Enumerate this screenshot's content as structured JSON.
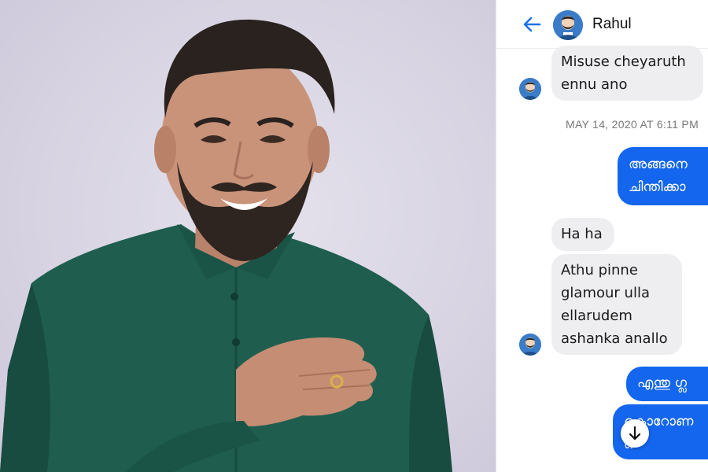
{
  "photo": {
    "description_icon": "smiling-man-photo"
  },
  "chat": {
    "header": {
      "contact_name": "Rahul",
      "back_icon": "arrow-left-icon"
    },
    "timestamp": "MAY 14, 2020 AT 6:11 PM",
    "messages": [
      {
        "from": "contact",
        "text_lines": [
          "Misuse cheyaruth",
          "ennu ano"
        ]
      },
      {
        "from": "me",
        "text_lines": [
          "അങ്ങനെ",
          "ചിന്തിക്കാ"
        ]
      },
      {
        "from": "contact",
        "text_lines": [
          "Ha ha"
        ]
      },
      {
        "from": "contact",
        "text_lines": [
          "Athu pinne",
          "glamour ulla",
          "ellarudem",
          "ashanka anallo"
        ]
      },
      {
        "from": "me",
        "text_lines": [
          "എന്തു ഗ്ല"
        ]
      },
      {
        "from": "me",
        "text_lines": [
          "കൊറോണ",
          "ഒ"
        ]
      }
    ],
    "scroll_button_icon": "arrow-down-icon",
    "colors": {
      "outgoing_bubble": "#1466ee",
      "incoming_bubble": "#eeeef1",
      "accent": "#1a73e8"
    }
  }
}
